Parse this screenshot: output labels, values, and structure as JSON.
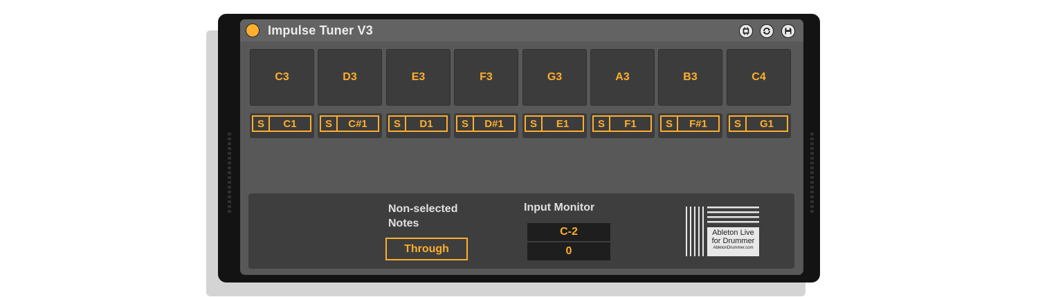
{
  "device": {
    "title": "Impulse Tuner V3",
    "accent_color": "#ffae2d",
    "header_icons": [
      "resize-icon",
      "refresh-icon",
      "save-icon"
    ]
  },
  "pads": [
    {
      "note": "C3",
      "map": "C1"
    },
    {
      "note": "D3",
      "map": "C#1"
    },
    {
      "note": "E3",
      "map": "D1"
    },
    {
      "note": "F3",
      "map": "D#1"
    },
    {
      "note": "G3",
      "map": "E1"
    },
    {
      "note": "A3",
      "map": "F1"
    },
    {
      "note": "B3",
      "map": "F#1"
    },
    {
      "note": "C4",
      "map": "G1"
    }
  ],
  "solo_label": "S",
  "non_selected": {
    "label_line1": "Non-selected",
    "label_line2": "Notes",
    "value": "Through"
  },
  "input_monitor": {
    "label": "Input Monitor",
    "note": "C-2",
    "velocity": "0"
  },
  "logo": {
    "line1": "Ableton Live",
    "line2": "for Drummer",
    "url": "AbletonDrummer.com"
  }
}
